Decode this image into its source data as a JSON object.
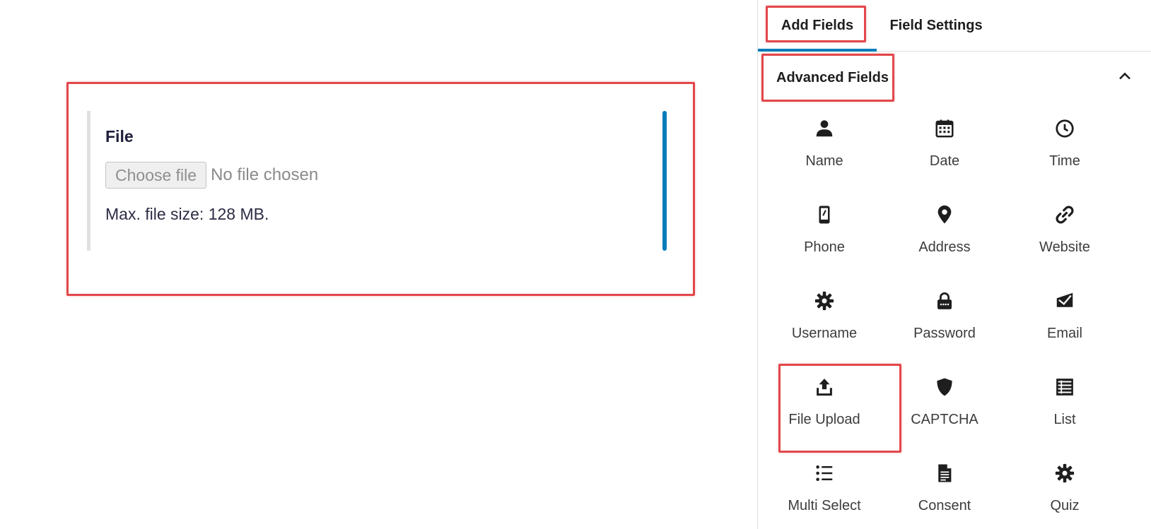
{
  "preview": {
    "field_label": "File",
    "choose_file_label": "Choose file",
    "no_file_text": "No file chosen",
    "max_size_text": "Max. file size: 128 MB."
  },
  "sidebar": {
    "tabs": [
      {
        "label": "Add Fields",
        "active": true
      },
      {
        "label": "Field Settings",
        "active": false
      }
    ],
    "panel": {
      "title": "Advanced Fields",
      "expanded": true,
      "fields": [
        {
          "label": "Name",
          "icon": "person-icon"
        },
        {
          "label": "Date",
          "icon": "calendar-icon"
        },
        {
          "label": "Time",
          "icon": "clock-icon"
        },
        {
          "label": "Phone",
          "icon": "phone-icon"
        },
        {
          "label": "Address",
          "icon": "map-pin-icon"
        },
        {
          "label": "Website",
          "icon": "link-icon"
        },
        {
          "label": "Username",
          "icon": "gear-icon"
        },
        {
          "label": "Password",
          "icon": "lock-icon"
        },
        {
          "label": "Email",
          "icon": "email-icon"
        },
        {
          "label": "File Upload",
          "icon": "upload-icon"
        },
        {
          "label": "CAPTCHA",
          "icon": "shield-icon"
        },
        {
          "label": "List",
          "icon": "list-icon"
        },
        {
          "label": "Multi Select",
          "icon": "bullet-list-icon"
        },
        {
          "label": "Consent",
          "icon": "document-icon"
        },
        {
          "label": "Quiz",
          "icon": "gear-icon"
        }
      ]
    }
  },
  "colors": {
    "highlight": "#e2474b",
    "accent": "#007cba"
  }
}
